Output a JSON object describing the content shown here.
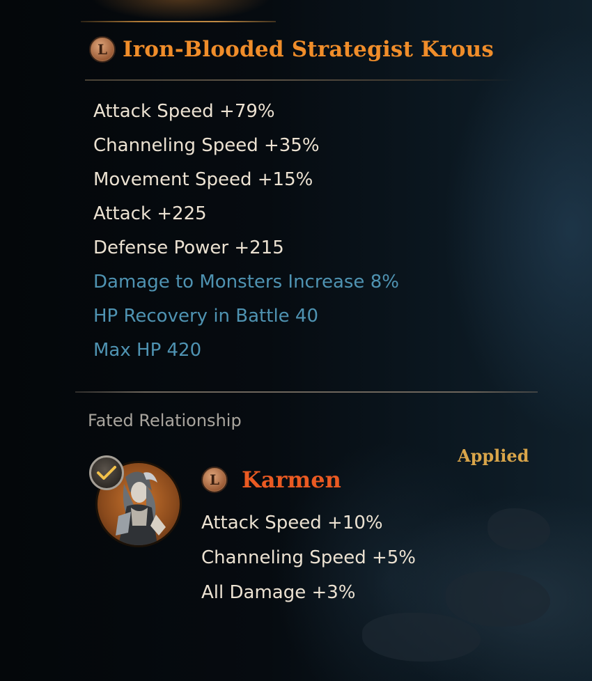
{
  "hero": {
    "grade_icon": "L",
    "name": "Iron-Blooded Strategist Krous"
  },
  "stats": [
    {
      "text": "Attack Speed +79%",
      "kind": "main"
    },
    {
      "text": "Channeling Speed +35%",
      "kind": "main"
    },
    {
      "text": "Movement Speed +15%",
      "kind": "main"
    },
    {
      "text": "Attack +225",
      "kind": "main"
    },
    {
      "text": "Defense Power +215",
      "kind": "main"
    },
    {
      "text": "Damage to Monsters Increase 8%",
      "kind": "sub"
    },
    {
      "text": "HP Recovery in Battle 40",
      "kind": "sub"
    },
    {
      "text": "Max HP 420",
      "kind": "sub"
    }
  ],
  "fated": {
    "section_title": "Fated Relationship",
    "status": "Applied",
    "partner": {
      "grade_icon": "L",
      "name": "Karmen",
      "portrait_icon": "karmen-portrait",
      "check_icon": "checkmark-icon",
      "stats": [
        "Attack Speed +10%",
        "Channeling Speed +5%",
        "All Damage +3%"
      ]
    }
  },
  "colors": {
    "name_orange": "#f08d2a",
    "partner_name": "#ea5a22",
    "main_stat": "#ece2d2",
    "sub_stat": "#4f93b2",
    "applied_gold": "#d9a54a"
  }
}
